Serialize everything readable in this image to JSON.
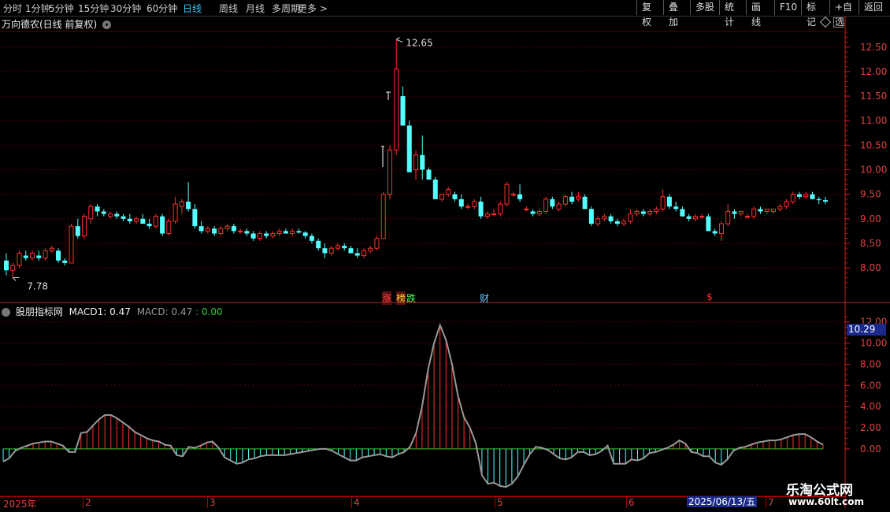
{
  "toolbar": {
    "timeframes": [
      "分时",
      "1分钟",
      "5分钟",
      "15分钟",
      "30分钟",
      "60分钟",
      "日线",
      "周线",
      "月线",
      "多周期",
      "更多 >"
    ],
    "active_timeframe": "日线",
    "right_buttons": [
      "复权",
      "叠加",
      "多股",
      "统计",
      "画线",
      "F10",
      "标记",
      "+自选",
      "返回"
    ]
  },
  "chart_title": "万向德农(日线 前复权)",
  "indicator": {
    "name": "股朋指标网",
    "macd1_label": "MACD1: 0.47",
    "macd_label": "MACD: 0.47",
    "zero_label": ": 0.00",
    "highlight_value": "10.29"
  },
  "annotations": {
    "high_label": "12.65",
    "low_label": "7.78",
    "markers": [
      {
        "text": "涨",
        "color": "#ff4040",
        "bg": "#5a1010"
      },
      {
        "text": "榜",
        "color": "#ffdd33",
        "bg": "#5a1010"
      },
      {
        "text": "跌",
        "color": "#55ff55",
        "bg": ""
      },
      {
        "text": "财",
        "color": "#66ccff",
        "bg": ""
      },
      {
        "text": "$",
        "color": "#ff3030",
        "bg": ""
      }
    ]
  },
  "chart_data": [
    {
      "type": "candlestick",
      "ylim": [
        7.6,
        12.85
      ],
      "y_ticks": [
        "12.50",
        "12.00",
        "11.50",
        "11.00",
        "10.50",
        "10.00",
        "9.50",
        "9.00",
        "8.50",
        "8.00"
      ],
      "y_tick_values": [
        12.5,
        12.0,
        11.5,
        11.0,
        10.5,
        10.0,
        9.5,
        9.0,
        8.5,
        8.0
      ],
      "colors": {
        "up": "#ff3030",
        "down": "#54ffff"
      },
      "ohlc": [
        [
          8.15,
          8.3,
          7.85,
          7.95
        ],
        [
          7.95,
          8.1,
          7.8,
          8.05
        ],
        [
          8.05,
          8.35,
          8.0,
          8.3
        ],
        [
          8.25,
          8.35,
          8.15,
          8.2
        ],
        [
          8.2,
          8.35,
          8.15,
          8.3
        ],
        [
          8.25,
          8.35,
          8.15,
          8.2
        ],
        [
          8.2,
          8.4,
          8.15,
          8.35
        ],
        [
          8.35,
          8.45,
          8.3,
          8.4
        ],
        [
          8.35,
          8.4,
          8.1,
          8.15
        ],
        [
          8.15,
          8.2,
          8.05,
          8.1
        ],
        [
          8.1,
          8.9,
          8.1,
          8.85
        ],
        [
          8.85,
          9.0,
          8.6,
          8.65
        ],
        [
          8.65,
          9.1,
          8.6,
          9.05
        ],
        [
          9.0,
          9.3,
          8.9,
          9.25
        ],
        [
          9.25,
          9.3,
          9.05,
          9.15
        ],
        [
          9.15,
          9.2,
          9.05,
          9.1
        ],
        [
          9.05,
          9.15,
          9.0,
          9.1
        ],
        [
          9.1,
          9.15,
          9.0,
          9.05
        ],
        [
          9.05,
          9.1,
          8.95,
          9.0
        ],
        [
          9.0,
          9.1,
          8.9,
          8.95
        ],
        [
          8.95,
          9.05,
          8.9,
          9.0
        ],
        [
          9.0,
          9.1,
          8.9,
          8.9
        ],
        [
          8.9,
          9.0,
          8.8,
          8.85
        ],
        [
          8.85,
          9.1,
          8.8,
          9.05
        ],
        [
          9.05,
          9.1,
          8.65,
          8.7
        ],
        [
          8.7,
          9.0,
          8.65,
          8.95
        ],
        [
          8.95,
          9.45,
          8.9,
          9.3
        ],
        [
          9.25,
          9.4,
          9.1,
          9.35
        ],
        [
          9.35,
          9.75,
          9.15,
          9.2
        ],
        [
          9.2,
          9.3,
          8.8,
          8.85
        ],
        [
          8.85,
          8.95,
          8.7,
          8.75
        ],
        [
          8.75,
          8.85,
          8.7,
          8.8
        ],
        [
          8.8,
          8.85,
          8.65,
          8.7
        ],
        [
          8.7,
          8.85,
          8.65,
          8.8
        ],
        [
          8.8,
          8.9,
          8.75,
          8.85
        ],
        [
          8.85,
          8.9,
          8.7,
          8.75
        ],
        [
          8.75,
          8.8,
          8.7,
          8.75
        ],
        [
          8.75,
          8.8,
          8.65,
          8.7
        ],
        [
          8.7,
          8.75,
          8.55,
          8.6
        ],
        [
          8.6,
          8.75,
          8.55,
          8.7
        ],
        [
          8.7,
          8.75,
          8.6,
          8.65
        ],
        [
          8.65,
          8.75,
          8.6,
          8.7
        ],
        [
          8.7,
          8.8,
          8.65,
          8.75
        ],
        [
          8.75,
          8.8,
          8.7,
          8.7
        ],
        [
          8.7,
          8.8,
          8.65,
          8.75
        ],
        [
          8.75,
          8.8,
          8.7,
          8.72
        ],
        [
          8.72,
          8.75,
          8.6,
          8.65
        ],
        [
          8.65,
          8.7,
          8.5,
          8.55
        ],
        [
          8.55,
          8.6,
          8.35,
          8.4
        ],
        [
          8.4,
          8.5,
          8.2,
          8.3
        ],
        [
          8.3,
          8.45,
          8.25,
          8.4
        ],
        [
          8.4,
          8.5,
          8.35,
          8.45
        ],
        [
          8.45,
          8.5,
          8.35,
          8.4
        ],
        [
          8.4,
          8.45,
          8.3,
          8.3
        ],
        [
          8.3,
          8.4,
          8.2,
          8.25
        ],
        [
          8.25,
          8.4,
          8.2,
          8.35
        ],
        [
          8.35,
          8.45,
          8.3,
          8.4
        ],
        [
          8.4,
          8.65,
          8.35,
          8.6
        ],
        [
          8.6,
          9.55,
          8.9,
          9.5
        ],
        [
          9.5,
          10.5,
          9.4,
          10.4
        ],
        [
          10.4,
          12.65,
          10.3,
          12.05
        ],
        [
          11.5,
          11.7,
          10.9,
          10.9
        ],
        [
          10.9,
          11.0,
          9.95,
          9.95
        ],
        [
          10.0,
          10.4,
          9.8,
          10.3
        ],
        [
          10.3,
          10.7,
          9.8,
          10.0
        ],
        [
          10.0,
          10.05,
          9.8,
          9.8
        ],
        [
          9.8,
          9.85,
          9.4,
          9.4
        ],
        [
          9.4,
          9.5,
          9.35,
          9.5
        ],
        [
          9.5,
          9.65,
          9.45,
          9.6
        ],
        [
          9.5,
          9.55,
          9.35,
          9.4
        ],
        [
          9.4,
          9.5,
          9.2,
          9.25
        ],
        [
          9.25,
          9.3,
          9.2,
          9.25
        ],
        [
          9.25,
          9.4,
          9.2,
          9.35
        ],
        [
          9.35,
          9.45,
          9.0,
          9.05
        ],
        [
          9.05,
          9.15,
          9.0,
          9.1
        ],
        [
          9.1,
          9.2,
          9.05,
          9.1
        ],
        [
          9.1,
          9.35,
          9.05,
          9.3
        ],
        [
          9.3,
          9.75,
          9.25,
          9.7
        ],
        [
          9.5,
          9.55,
          9.45,
          9.5
        ],
        [
          9.5,
          9.7,
          9.35,
          9.4
        ],
        [
          9.2,
          9.25,
          9.15,
          9.2
        ],
        [
          9.15,
          9.2,
          9.05,
          9.1
        ],
        [
          9.1,
          9.2,
          9.05,
          9.15
        ],
        [
          9.15,
          9.45,
          9.1,
          9.4
        ],
        [
          9.4,
          9.45,
          9.2,
          9.25
        ],
        [
          9.2,
          9.35,
          9.15,
          9.3
        ],
        [
          9.3,
          9.5,
          9.25,
          9.45
        ],
        [
          9.45,
          9.55,
          9.3,
          9.35
        ],
        [
          9.4,
          9.55,
          9.35,
          9.45
        ],
        [
          9.45,
          9.5,
          9.2,
          9.2
        ],
        [
          9.2,
          9.25,
          8.85,
          8.9
        ],
        [
          8.9,
          9.05,
          8.85,
          9.0
        ],
        [
          9.0,
          9.1,
          8.95,
          9.05
        ],
        [
          9.05,
          9.1,
          8.9,
          8.95
        ],
        [
          8.95,
          9.0,
          8.85,
          8.9
        ],
        [
          8.9,
          9.0,
          8.85,
          8.95
        ],
        [
          8.95,
          9.2,
          8.9,
          9.1
        ],
        [
          9.1,
          9.2,
          9.05,
          9.15
        ],
        [
          9.15,
          9.2,
          9.05,
          9.1
        ],
        [
          9.1,
          9.2,
          9.05,
          9.15
        ],
        [
          9.15,
          9.25,
          9.1,
          9.2
        ],
        [
          9.2,
          9.6,
          9.15,
          9.45
        ],
        [
          9.45,
          9.5,
          9.2,
          9.25
        ],
        [
          9.25,
          9.35,
          9.15,
          9.2
        ],
        [
          9.2,
          9.25,
          9.05,
          9.05
        ],
        [
          9.05,
          9.1,
          8.95,
          9.0
        ],
        [
          9.0,
          9.1,
          8.95,
          9.05
        ],
        [
          9.05,
          9.1,
          9.0,
          9.05
        ],
        [
          9.05,
          9.1,
          8.75,
          8.75
        ],
        [
          8.75,
          8.8,
          8.65,
          8.7
        ],
        [
          8.7,
          8.95,
          8.55,
          8.9
        ],
        [
          8.9,
          9.3,
          8.85,
          9.15
        ],
        [
          9.15,
          9.2,
          9.0,
          9.1
        ],
        [
          9.1,
          9.15,
          9.05,
          9.15
        ],
        [
          9.05,
          9.1,
          9.0,
          9.05
        ],
        [
          9.05,
          9.25,
          9.0,
          9.2
        ],
        [
          9.2,
          9.25,
          9.1,
          9.15
        ],
        [
          9.15,
          9.2,
          9.1,
          9.2
        ],
        [
          9.15,
          9.2,
          9.1,
          9.2
        ],
        [
          9.2,
          9.3,
          9.15,
          9.25
        ],
        [
          9.25,
          9.4,
          9.2,
          9.35
        ],
        [
          9.35,
          9.55,
          9.3,
          9.5
        ],
        [
          9.5,
          9.55,
          9.4,
          9.45
        ],
        [
          9.45,
          9.55,
          9.4,
          9.5
        ],
        [
          9.5,
          9.55,
          9.4,
          9.4
        ],
        [
          9.4,
          9.45,
          9.3,
          9.38
        ],
        [
          9.38,
          9.45,
          9.3,
          9.35
        ]
      ]
    },
    {
      "type": "macd",
      "ylim": [
        -1.5,
        12.8
      ],
      "y_ticks": [
        "12.00",
        "10.00",
        "8.00",
        "6.00",
        "4.00",
        "2.00",
        "0.00"
      ],
      "y_tick_values": [
        12,
        10,
        8,
        6,
        4,
        2,
        0
      ],
      "colors": {
        "line": "#999999",
        "positive": "#ff3030",
        "negative": "#54ffff",
        "zero": "#33cc33"
      },
      "values": [
        -1.2,
        -0.9,
        -0.2,
        0.1,
        0.3,
        0.5,
        0.6,
        0.7,
        0.7,
        0.5,
        0.3,
        -0.3,
        -0.3,
        1.5,
        1.6,
        2.2,
        2.8,
        3.2,
        3.2,
        2.9,
        2.5,
        2.1,
        1.6,
        1.3,
        1.0,
        0.8,
        0.7,
        0.4,
        0.3,
        -0.6,
        -0.7,
        0.2,
        0.1,
        0.3,
        0.6,
        0.7,
        0.1,
        -0.8,
        -1.1,
        -1.4,
        -1.3,
        -1.0,
        -0.9,
        -0.7,
        -0.6,
        -0.6,
        -0.6,
        -0.6,
        -0.5,
        -0.4,
        -0.3,
        -0.2,
        -0.1,
        0.0,
        0.0,
        -0.2,
        -0.5,
        -0.8,
        -1.1,
        -1.1,
        -0.8,
        -0.7,
        -0.6,
        -0.5,
        -0.7,
        -0.8,
        -0.5,
        -0.3,
        0.2,
        1.5,
        4.0,
        7.5,
        10.0,
        11.7,
        10.3,
        8.0,
        5.0,
        3.0,
        2.0,
        0.5,
        -2.5,
        -3.3,
        -3.2,
        -3.5,
        -3.6,
        -3.3,
        -2.6,
        -1.5,
        -0.5,
        0.2,
        0.1,
        -0.1,
        -0.5,
        -0.9,
        -1.0,
        -0.8,
        -0.3,
        -0.3,
        -0.6,
        -0.5,
        -0.2,
        0.3,
        -1.4,
        -1.4,
        -1.4,
        -1.0,
        -1.1,
        -0.9,
        -0.4,
        -0.3,
        -0.1,
        0.1,
        0.4,
        0.8,
        0.5,
        -0.3,
        -0.4,
        -0.7,
        -0.7,
        -1.3,
        -1.5,
        -1.0,
        -0.2,
        0.1,
        0.2,
        0.4,
        0.6,
        0.7,
        0.8,
        0.8,
        0.9,
        1.1,
        1.3,
        1.4,
        1.4,
        1.1,
        0.7,
        0.4
      ]
    }
  ],
  "date_axis": {
    "labels": [
      "2025年",
      "2",
      "3",
      "4",
      "5",
      "6",
      "7"
    ],
    "cursor_date": "2025/06/13/五"
  },
  "watermark": {
    "line1": "乐淘公式网",
    "line2": "www.60lt.com"
  }
}
